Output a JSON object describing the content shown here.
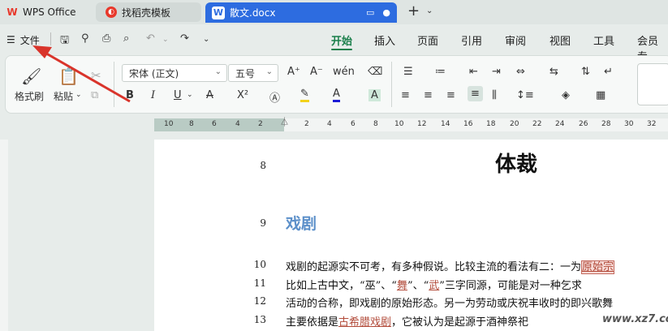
{
  "tabs": {
    "wps_label": "WPS Office",
    "template_label": "找稻壳模板",
    "doc_label": "散文.docx",
    "new_tab": "+"
  },
  "menu": {
    "file_label": "文件",
    "tabs": [
      "开始",
      "插入",
      "页面",
      "引用",
      "审阅",
      "视图",
      "工具",
      "会员专"
    ]
  },
  "ribbon": {
    "format_painter": "格式刷",
    "paste": "粘贴",
    "font_name": "宋体 (正文)",
    "font_size": "五号"
  },
  "ruler": {
    "left_ticks": [
      "10",
      "8",
      "6",
      "4",
      "2"
    ],
    "right_ticks": [
      "2",
      "4",
      "6",
      "8",
      "10",
      "12",
      "14",
      "16",
      "18",
      "20",
      "22",
      "24",
      "26",
      "28",
      "30",
      "32"
    ]
  },
  "document": {
    "line_numbers": [
      "8",
      "9",
      "10",
      "11",
      "12",
      "13"
    ],
    "title": "体裁",
    "heading": "戏剧",
    "lines": [
      {
        "a": "戏剧的起源实不可考，有多种假说。比较主流的看法有二：一为",
        "b": "原始宗"
      },
      {
        "a": "比如上古中文，“巫”、“",
        "b": "舞",
        "c": "”、“",
        "d": "武",
        "e": "”三字同源，可能是对一种乞求"
      },
      {
        "a": "活动的合称，即戏剧的原始形态。另一为劳动或庆祝丰收时的即兴歌舞"
      },
      {
        "a": "主要依据是",
        "b": "古希腊戏剧",
        "c": "，它被认为是起源于酒神祭祀"
      }
    ]
  },
  "watermark": "www.xz7.com",
  "colors": {
    "accent_green": "#1a7f4b",
    "doc_tab_blue": "#2d6ce0",
    "heading_blue": "#5b8fc9",
    "arrow_red": "#d9342b"
  }
}
